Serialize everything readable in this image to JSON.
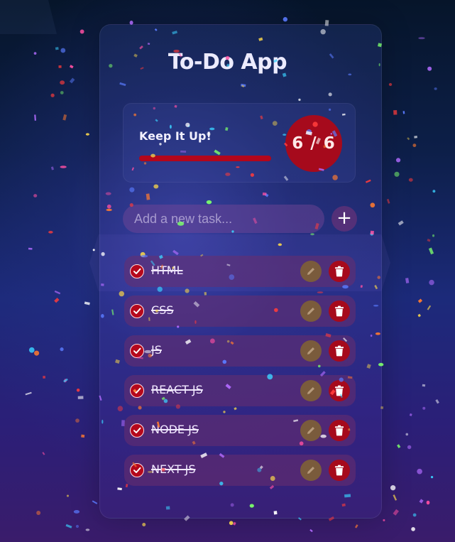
{
  "app": {
    "title": "To-Do App"
  },
  "stats": {
    "label": "Keep It Up!",
    "completed": 6,
    "total": 6,
    "count_text": "6 / 6",
    "progress_fraction": 1.0
  },
  "add": {
    "placeholder": "Add a new task...",
    "button_label": "+"
  },
  "tasks": [
    {
      "text": "HTML",
      "done": true
    },
    {
      "text": "CSS",
      "done": true
    },
    {
      "text": "JS",
      "done": true
    },
    {
      "text": "REACT JS",
      "done": true
    },
    {
      "text": "NODE JS",
      "done": true
    },
    {
      "text": "NEXT JS",
      "done": true
    }
  ],
  "icons": {
    "check": "check-icon",
    "edit": "pencil-icon",
    "delete": "trash-icon",
    "add": "plus-icon"
  },
  "colors": {
    "accent_red": "#a60a1c",
    "edit_brown": "#7a5b3c",
    "task_bg": "#692d6e"
  }
}
